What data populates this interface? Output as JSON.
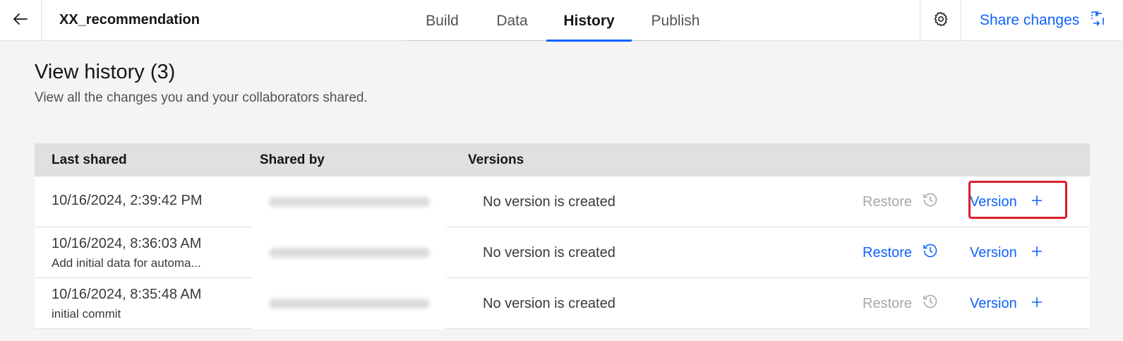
{
  "header": {
    "app_title": "XX_recommendation",
    "tabs": [
      {
        "label": "Build",
        "active": false
      },
      {
        "label": "Data",
        "active": false
      },
      {
        "label": "History",
        "active": true
      },
      {
        "label": "Publish",
        "active": false
      }
    ],
    "share_label": "Share changes",
    "accent_color": "#0f62fe"
  },
  "main": {
    "title": "View history (3)",
    "subtitle": "View all the changes you and your collaborators shared."
  },
  "table": {
    "columns": [
      "Last shared",
      "Shared by",
      "Versions"
    ],
    "rows": [
      {
        "date": "10/16/2024, 2:39:42 PM",
        "description": "",
        "versions": "No version is created",
        "restore_label": "Restore",
        "restore_enabled": false,
        "version_label": "Version",
        "highlighted": true
      },
      {
        "date": "10/16/2024, 8:36:03 AM",
        "description": "Add initial data for automa...",
        "versions": "No version is created",
        "restore_label": "Restore",
        "restore_enabled": true,
        "version_label": "Version",
        "highlighted": false
      },
      {
        "date": "10/16/2024, 8:35:48 AM",
        "description": "initial commit",
        "versions": "No version is created",
        "restore_label": "Restore",
        "restore_enabled": false,
        "version_label": "Version",
        "highlighted": false
      }
    ]
  },
  "icons": {
    "back": "arrow-left-icon",
    "settings": "gear-icon",
    "share": "sync-arrows-icon",
    "restore": "history-icon",
    "version_add": "plus-icon"
  },
  "colors": {
    "highlight_box": "#da1e28",
    "disabled_text": "#a8a8a8"
  }
}
